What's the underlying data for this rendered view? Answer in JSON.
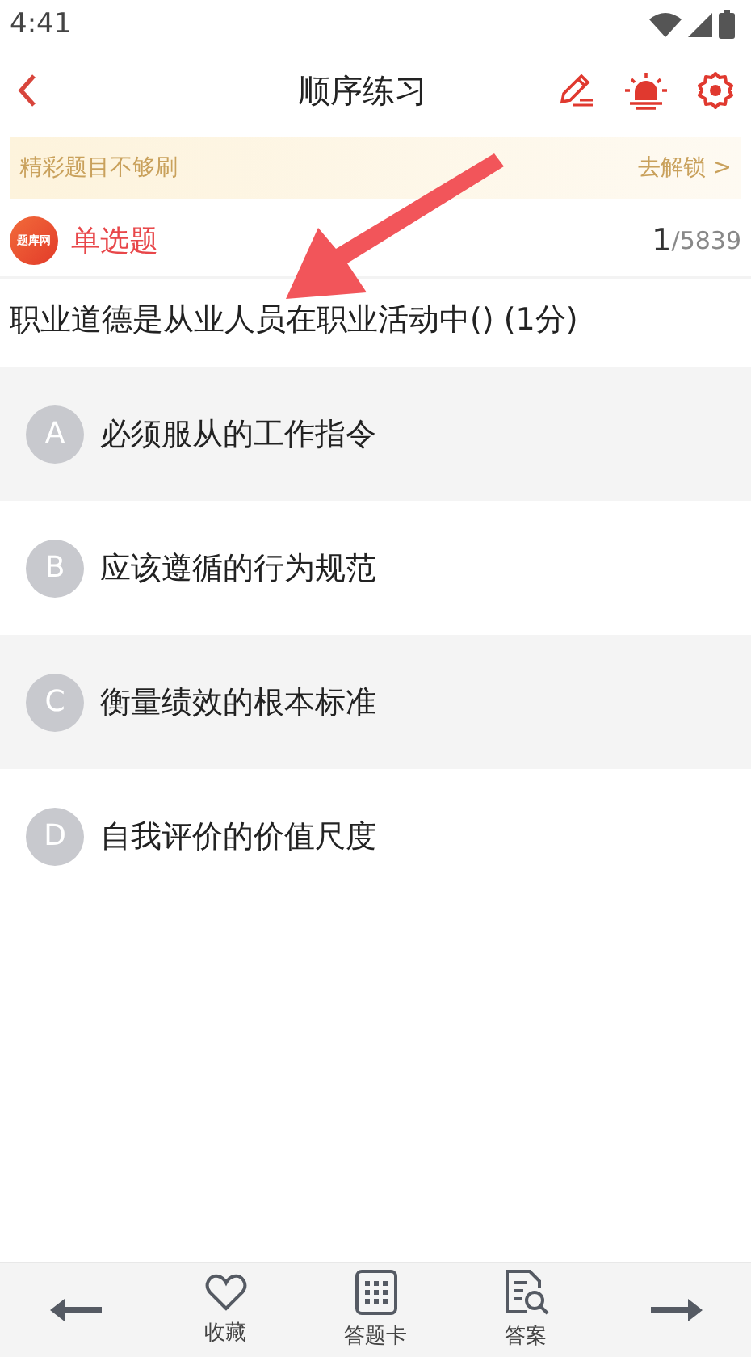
{
  "status_bar": {
    "time": "4:41"
  },
  "header": {
    "title": "顺序练习"
  },
  "banner": {
    "text": "精彩题目不够刷",
    "link": "去解锁 >"
  },
  "question_type": {
    "badge": "题库网",
    "label": "单选题",
    "current": "1",
    "total": "/5839"
  },
  "question": {
    "text": "职业道德是从业人员在职业活动中() (1分)"
  },
  "options": [
    {
      "letter": "A",
      "text": "必须服从的工作指令"
    },
    {
      "letter": "B",
      "text": "应该遵循的行为规范"
    },
    {
      "letter": "C",
      "text": "衡量绩效的根本标准"
    },
    {
      "letter": "D",
      "text": "自我评价的价值尺度"
    }
  ],
  "bottom_bar": [
    {
      "kind": "prev"
    },
    {
      "kind": "favorite",
      "label": "收藏"
    },
    {
      "kind": "card",
      "label": "答题卡"
    },
    {
      "kind": "answer",
      "label": "答案"
    },
    {
      "kind": "next"
    }
  ]
}
